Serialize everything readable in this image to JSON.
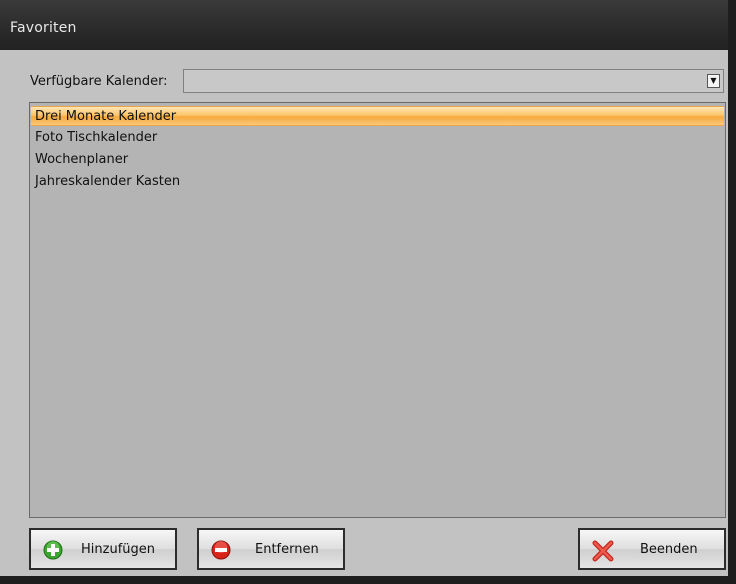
{
  "window": {
    "title": "Favoriten"
  },
  "calendar_picker": {
    "label": "Verfügbare Kalender:",
    "value": ""
  },
  "list": {
    "items": [
      {
        "label": "Drei Monate Kalender",
        "selected": true
      },
      {
        "label": "Foto Tischkalender",
        "selected": false
      },
      {
        "label": "Wochenplaner",
        "selected": false
      },
      {
        "label": "Jahreskalender Kasten",
        "selected": false
      }
    ]
  },
  "buttons": {
    "add": {
      "label": "Hinzufügen",
      "icon": "plus-circle-icon",
      "color": "#3aa52f"
    },
    "remove": {
      "label": "Entfernen",
      "icon": "minus-circle-icon",
      "color": "#d9241c"
    },
    "exit": {
      "label": "Beenden",
      "icon": "close-x-icon",
      "color": "#e0382b"
    }
  },
  "colors": {
    "selection": "#f7a93c",
    "titlebar": "#2a2a2a"
  }
}
